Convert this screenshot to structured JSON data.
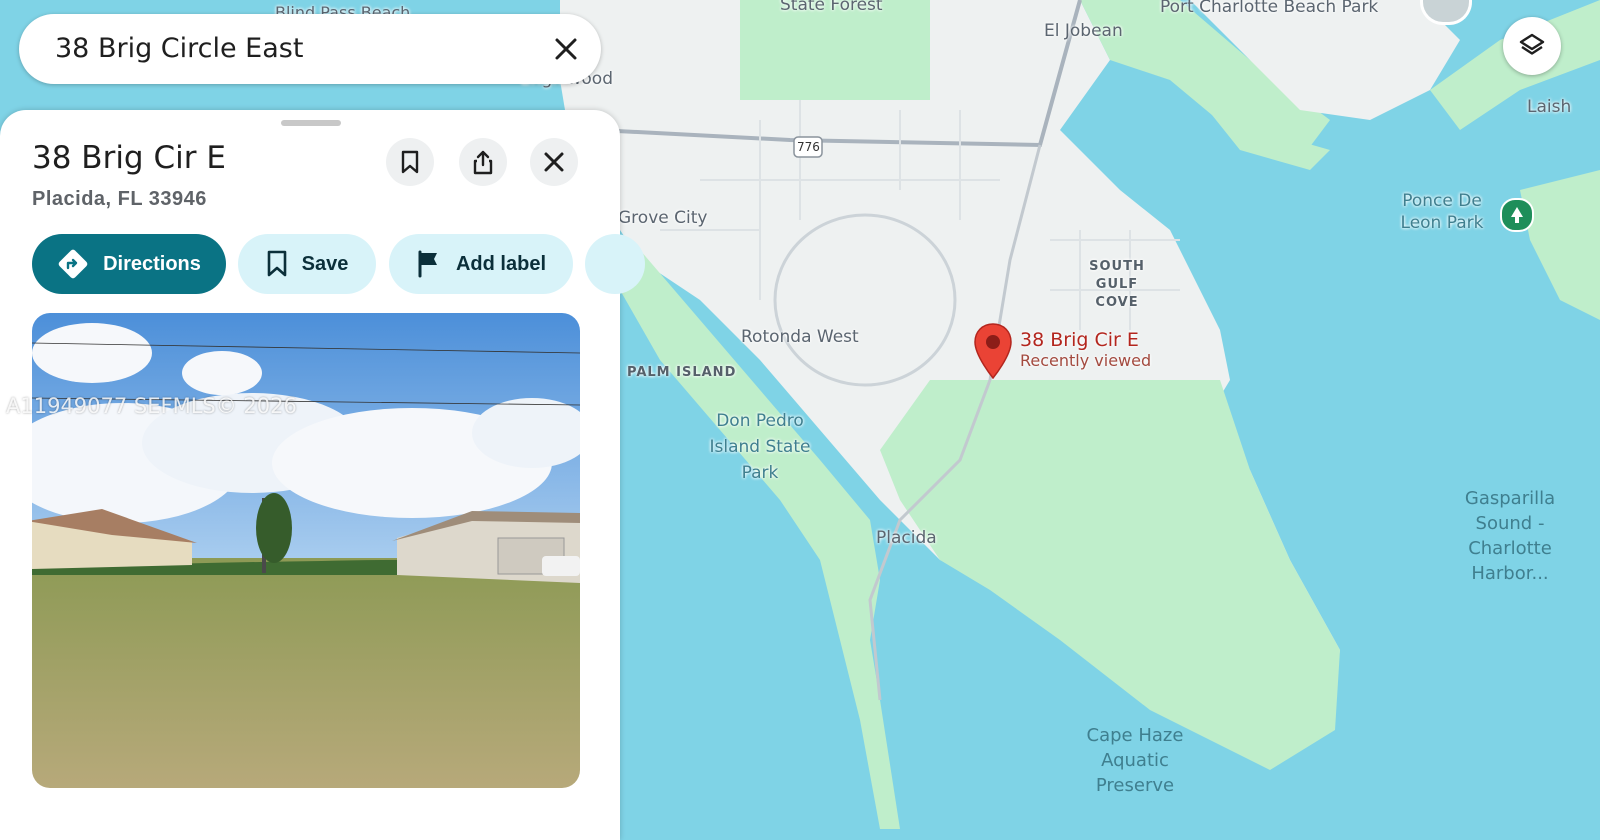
{
  "search": {
    "query": "38 Brig Circle East"
  },
  "place": {
    "title": "38 Brig Cir E",
    "subtitle": "Placida, FL 33946",
    "actions": {
      "directions": "Directions",
      "save": "Save",
      "add_label": "Add label"
    }
  },
  "marker": {
    "title": "38 Brig Cir E",
    "subtitle": "Recently viewed",
    "color": "#ea4335"
  },
  "map_labels": {
    "blind_pass": "Blind Pass Beach",
    "state_forest": "State Forest",
    "el_jobean": "El Jobean",
    "port_charlotte": "Port Charlotte Beach Park",
    "englewood": "Englewood",
    "highway": "776",
    "laish": "Laish",
    "ponce": "Ponce De Leon Park",
    "grove_city": "Grove City",
    "south_gulf": "SOUTH GULF COVE",
    "rotonda": "Rotonda West",
    "palm_island": "PALM ISLAND",
    "don_pedro": "Don Pedro Island State Park",
    "placida": "Placida",
    "gasparilla": "Gasparilla Sound - Charlotte Harbor...",
    "cape_haze": "Cape Haze Aquatic Preserve"
  },
  "watermark": "A11949077  SEFMLS© 2026",
  "colors": {
    "water": "#7fd3e6",
    "land": "#eef1f1",
    "park": "#bfeecb",
    "primary": "#0a7384",
    "chip_light": "#d8f3f9"
  },
  "icons": [
    "close-icon",
    "bookmark-icon",
    "share-icon",
    "directions-icon",
    "flag-icon",
    "layers-icon",
    "map-pin-icon",
    "park-icon"
  ]
}
